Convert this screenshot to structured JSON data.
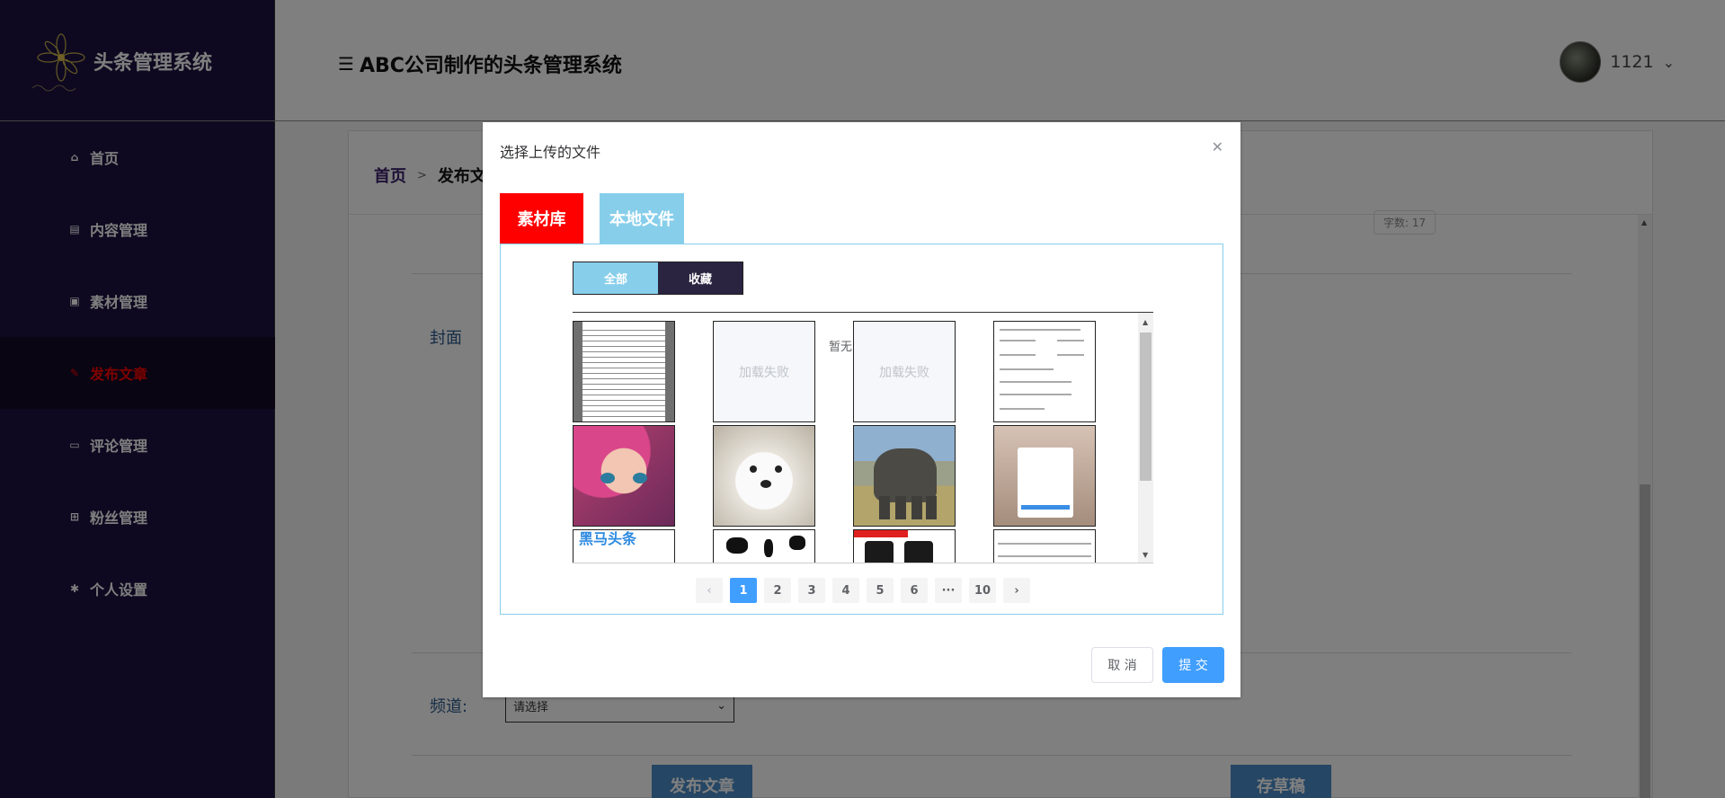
{
  "app": {
    "brand": "头条管理系统",
    "header_title": "ABC公司制作的头条管理系统",
    "user_name": "1121"
  },
  "sidebar": {
    "items": [
      {
        "label": "首页",
        "icon": "home-icon"
      },
      {
        "label": "内容管理",
        "icon": "document-icon"
      },
      {
        "label": "素材管理",
        "icon": "image-icon"
      },
      {
        "label": "发布文章",
        "icon": "edit-icon"
      },
      {
        "label": "评论管理",
        "icon": "comment-icon"
      },
      {
        "label": "粉丝管理",
        "icon": "gift-icon"
      },
      {
        "label": "个人设置",
        "icon": "gear-icon"
      }
    ],
    "active_label": "发布文章"
  },
  "page": {
    "breadcrumb_home": "首页",
    "breadcrumb_current": "发布文",
    "cover_label": "封面",
    "channel_label": "频道:",
    "channel_select_value": "请选择",
    "publish_button": "发布文章",
    "draft_button": "存草稿",
    "word_count": "字数: 17"
  },
  "dialog": {
    "title": "选择上传的文件",
    "tab_library": "素材库",
    "tab_local": "本地文件",
    "filter_all": "全部",
    "filter_favorite": "收藏",
    "load_failed": "加载失败",
    "empty_text": "暂无",
    "cancel": "取 消",
    "submit": "提 交",
    "banner_text": "黑马头条",
    "pagination": {
      "prev": "‹",
      "next": "›",
      "pages": [
        "1",
        "2",
        "3",
        "4",
        "5",
        "6",
        "···",
        "10"
      ],
      "current": "1"
    }
  },
  "colors": {
    "sidebar_bg": "#1d1340",
    "active_nav": "#ff0000",
    "tab_library": "#ff0000",
    "tab_local": "#87ceeb",
    "primary": "#409eff"
  }
}
